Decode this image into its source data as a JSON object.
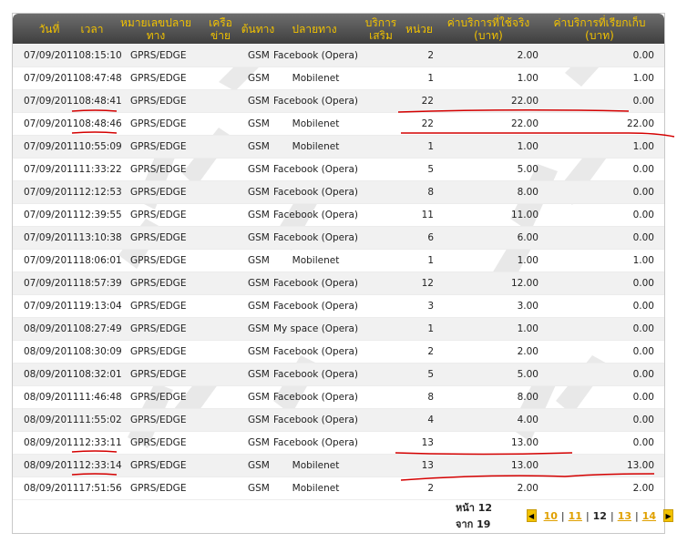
{
  "columns": {
    "date": "วันที่",
    "time": "เวลา",
    "dest_number": "หมายเลขปลายทาง",
    "network": "เครือข่าย",
    "origin": "ต้นทาง",
    "destination": "ปลายทาง",
    "service": "บริการเสริม",
    "units": "หน่วย",
    "actual_charge": "ค่าบริการที่ใช้จริง (บาท)",
    "billed_charge": "ค่าบริการที่เรียกเก็บ (บาท)"
  },
  "rows": [
    {
      "datetime": "07/09/201108:15:10",
      "type": "GPRS/EDGE",
      "network": "GSM",
      "destination": "Facebook (Opera)",
      "units": "2",
      "actual": "2.00",
      "billed": "0.00"
    },
    {
      "datetime": "07/09/201108:47:48",
      "type": "GPRS/EDGE",
      "network": "GSM",
      "destination": "Mobilenet",
      "units": "1",
      "actual": "1.00",
      "billed": "1.00"
    },
    {
      "datetime": "07/09/201108:48:41",
      "type": "GPRS/EDGE",
      "network": "GSM",
      "destination": "Facebook (Opera)",
      "units": "22",
      "actual": "22.00",
      "billed": "0.00"
    },
    {
      "datetime": "07/09/201108:48:46",
      "type": "GPRS/EDGE",
      "network": "GSM",
      "destination": "Mobilenet",
      "units": "22",
      "actual": "22.00",
      "billed": "22.00"
    },
    {
      "datetime": "07/09/201110:55:09",
      "type": "GPRS/EDGE",
      "network": "GSM",
      "destination": "Mobilenet",
      "units": "1",
      "actual": "1.00",
      "billed": "1.00"
    },
    {
      "datetime": "07/09/201111:33:22",
      "type": "GPRS/EDGE",
      "network": "GSM",
      "destination": "Facebook (Opera)",
      "units": "5",
      "actual": "5.00",
      "billed": "0.00"
    },
    {
      "datetime": "07/09/201112:12:53",
      "type": "GPRS/EDGE",
      "network": "GSM",
      "destination": "Facebook (Opera)",
      "units": "8",
      "actual": "8.00",
      "billed": "0.00"
    },
    {
      "datetime": "07/09/201112:39:55",
      "type": "GPRS/EDGE",
      "network": "GSM",
      "destination": "Facebook (Opera)",
      "units": "11",
      "actual": "11.00",
      "billed": "0.00"
    },
    {
      "datetime": "07/09/201113:10:38",
      "type": "GPRS/EDGE",
      "network": "GSM",
      "destination": "Facebook (Opera)",
      "units": "6",
      "actual": "6.00",
      "billed": "0.00"
    },
    {
      "datetime": "07/09/201118:06:01",
      "type": "GPRS/EDGE",
      "network": "GSM",
      "destination": "Mobilenet",
      "units": "1",
      "actual": "1.00",
      "billed": "1.00"
    },
    {
      "datetime": "07/09/201118:57:39",
      "type": "GPRS/EDGE",
      "network": "GSM",
      "destination": "Facebook (Opera)",
      "units": "12",
      "actual": "12.00",
      "billed": "0.00"
    },
    {
      "datetime": "07/09/201119:13:04",
      "type": "GPRS/EDGE",
      "network": "GSM",
      "destination": "Facebook (Opera)",
      "units": "3",
      "actual": "3.00",
      "billed": "0.00"
    },
    {
      "datetime": "08/09/201108:27:49",
      "type": "GPRS/EDGE",
      "network": "GSM",
      "destination": "My space (Opera)",
      "units": "1",
      "actual": "1.00",
      "billed": "0.00"
    },
    {
      "datetime": "08/09/201108:30:09",
      "type": "GPRS/EDGE",
      "network": "GSM",
      "destination": "Facebook (Opera)",
      "units": "2",
      "actual": "2.00",
      "billed": "0.00"
    },
    {
      "datetime": "08/09/201108:32:01",
      "type": "GPRS/EDGE",
      "network": "GSM",
      "destination": "Facebook (Opera)",
      "units": "5",
      "actual": "5.00",
      "billed": "0.00"
    },
    {
      "datetime": "08/09/201111:46:48",
      "type": "GPRS/EDGE",
      "network": "GSM",
      "destination": "Facebook (Opera)",
      "units": "8",
      "actual": "8.00",
      "billed": "0.00"
    },
    {
      "datetime": "08/09/201111:55:02",
      "type": "GPRS/EDGE",
      "network": "GSM",
      "destination": "Facebook (Opera)",
      "units": "4",
      "actual": "4.00",
      "billed": "0.00"
    },
    {
      "datetime": "08/09/201112:33:11",
      "type": "GPRS/EDGE",
      "network": "GSM",
      "destination": "Facebook (Opera)",
      "units": "13",
      "actual": "13.00",
      "billed": "0.00"
    },
    {
      "datetime": "08/09/201112:33:14",
      "type": "GPRS/EDGE",
      "network": "GSM",
      "destination": "Mobilenet",
      "units": "13",
      "actual": "13.00",
      "billed": "13.00"
    },
    {
      "datetime": "08/09/201117:51:56",
      "type": "GPRS/EDGE",
      "network": "GSM",
      "destination": "Mobilenet",
      "units": "2",
      "actual": "2.00",
      "billed": "2.00"
    }
  ],
  "pager": {
    "label": "หน้า 12 จาก 19",
    "pages": [
      "10",
      "11",
      "12",
      "13",
      "14"
    ],
    "current": "12",
    "prev_icon": "triangle-left-icon",
    "next_icon": "triangle-right-icon"
  },
  "colors": {
    "header_bg": "#4a4a4a",
    "header_text": "#f2c200",
    "row_alt": "#f1f1f1",
    "annotation": "#d40000"
  }
}
